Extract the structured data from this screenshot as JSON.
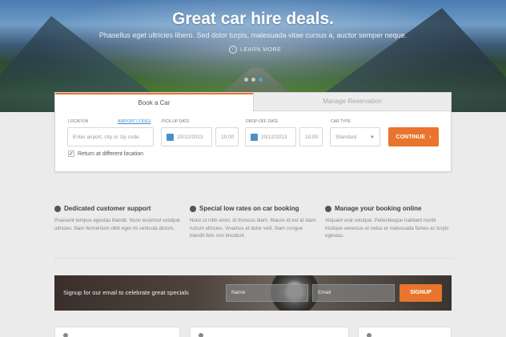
{
  "hero": {
    "title": "Great car hire deals.",
    "subtitle": "Phasellus eget ultricies libero. Sed dolor turpis, malesuada vitae cursus a, auctor semper neque.",
    "learn_more": "LEARN MORE",
    "learn_icon": "chevron-right-circle-icon",
    "slide_count": 3,
    "active_slide": 3
  },
  "booking": {
    "tabs": [
      {
        "label": "Book a Car",
        "active": true
      },
      {
        "label": "Manage Reservation",
        "active": false
      }
    ],
    "location": {
      "label": "LOCATION",
      "link": "AIRPORT CODES",
      "placeholder": "Enter airport, city or zip code"
    },
    "pickup": {
      "label": "PICK-UP DATE",
      "date": "20/12/2013",
      "time": "10:00"
    },
    "dropoff": {
      "label": "DROP-OFF DATE",
      "date": "20/12/2013",
      "time": "10:00"
    },
    "car_type": {
      "label": "CAR TYPE",
      "value": "Standard"
    },
    "continue_label": "CONTINUE",
    "return_checkbox": {
      "label": "Return at different location",
      "checked": true
    }
  },
  "features": [
    {
      "title": "Dedicated customer support",
      "icon": "support-icon",
      "text": "Praesent tempus egestas blandit. Nunc euismod volutpat ultricies. Nam fermentum nibh eget mi vehicula dictum."
    },
    {
      "title": "Special low rates on car booking",
      "icon": "tag-icon",
      "text": "Nunc ut nibh enim, id rhoncus diam. Mauris id est at diam rutrum ultricies. Vivamus et dolor velit. Nam congue blandit felis non tincidunt."
    },
    {
      "title": "Manage your booking online",
      "icon": "edit-icon",
      "text": "Aliquam erat volutpat. Pellentesque habitant morbi tristique senectus et netus et malesuada fames ac turpis egestas."
    }
  ],
  "signup": {
    "text": "Signup for our email to celebrate great specials",
    "name_placeholder": "Name",
    "email_placeholder": "Email",
    "button_label": "SIGNUP"
  },
  "colors": {
    "accent": "#e8742e",
    "link": "#3b8ed0"
  }
}
